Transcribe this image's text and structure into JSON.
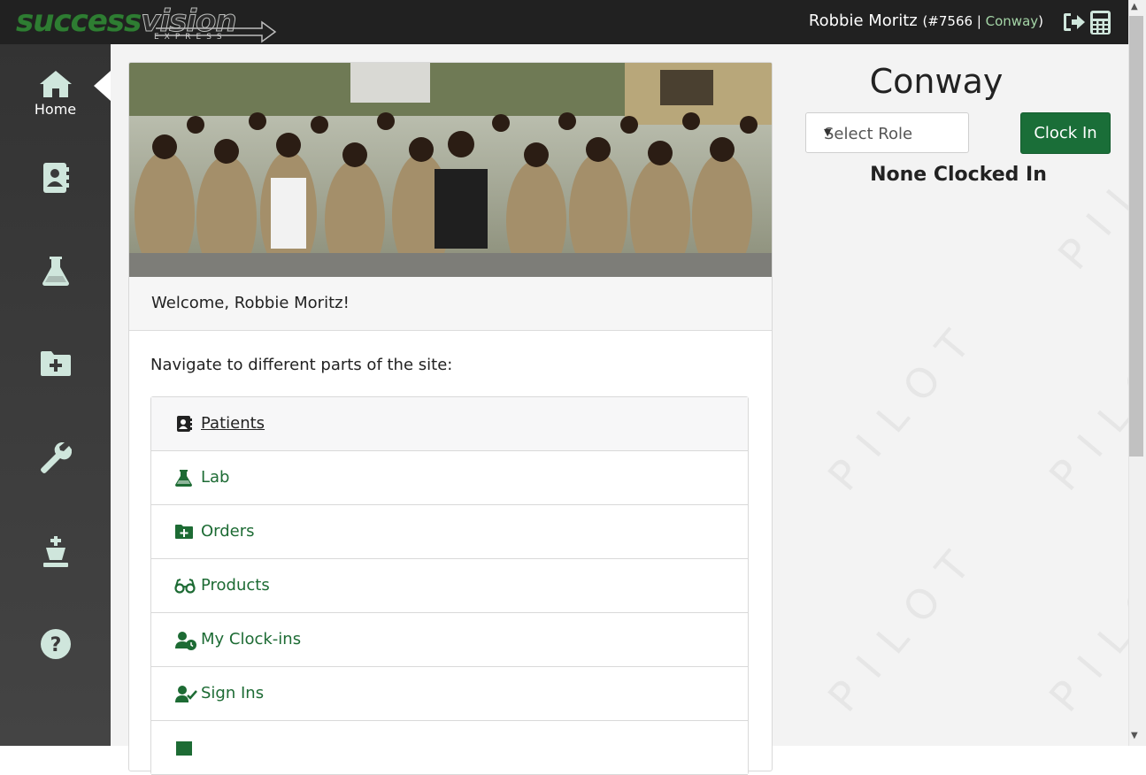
{
  "header": {
    "logo_top": "success",
    "logo_top_b": "vision",
    "logo_sub": "EXPRESS",
    "user_name": "Robbie Moritz",
    "user_id": "(#7566",
    "separator": " | ",
    "location": "Conway",
    "close_paren": ")",
    "logout_icon": "sign-out-icon",
    "calculator_icon": "calculator-icon"
  },
  "sidebar": {
    "items": [
      {
        "icon": "home-icon",
        "label": "Home"
      },
      {
        "icon": "patients-icon",
        "label": ""
      },
      {
        "icon": "lab-icon",
        "label": ""
      },
      {
        "icon": "orders-icon",
        "label": ""
      },
      {
        "icon": "wrench-icon",
        "label": ""
      },
      {
        "icon": "chess-king-icon",
        "label": ""
      },
      {
        "icon": "help-icon",
        "label": ""
      }
    ]
  },
  "welcome": {
    "greeting": "Welcome, Robbie Moritz!",
    "nav_intro": "Navigate to different parts of the site:"
  },
  "nav": [
    {
      "icon": "address-book-icon",
      "label": "Patients",
      "active": true
    },
    {
      "icon": "flask-icon",
      "label": "Lab"
    },
    {
      "icon": "folder-plus-icon",
      "label": "Orders"
    },
    {
      "icon": "glasses-icon",
      "label": "Products"
    },
    {
      "icon": "user-clock-icon",
      "label": "My Clock-ins"
    },
    {
      "icon": "user-check-icon",
      "label": "Sign Ins"
    },
    {
      "icon": "report-icon",
      "label": ""
    }
  ],
  "right_panel": {
    "location_title": "Conway",
    "role_select_value": "Select Role",
    "clock_in_label": "Clock In",
    "status": "None Clocked In",
    "watermark": "PILOT"
  },
  "colors": {
    "brand_green": "#1a6e38",
    "sidebar_icon": "#cfe6dc",
    "topbar": "#212121"
  }
}
